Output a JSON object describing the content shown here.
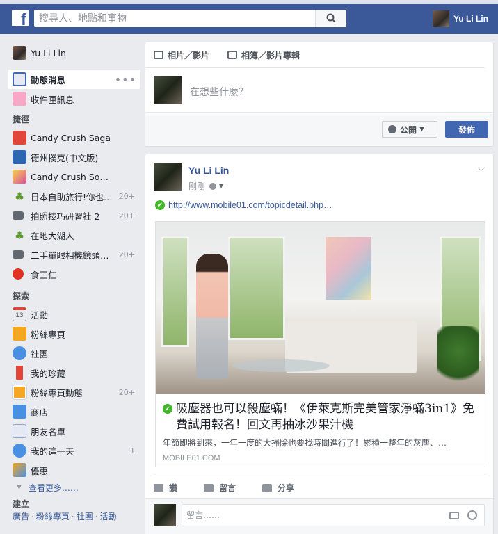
{
  "topbar": {
    "logo": "f",
    "search_placeholder": "搜尋人、地點和事物",
    "user_name": "Yu Li Lin"
  },
  "leftnav": {
    "profile_name": "Yu Li Lin",
    "main_items": [
      {
        "label": "動態消息",
        "icon": "news-feed-icon",
        "more": "•••"
      },
      {
        "label": "收件匣訊息",
        "icon": "messages-icon"
      }
    ],
    "shortcuts_header": "捷徑",
    "shortcuts": [
      {
        "label": "Candy Crush Saga",
        "icon": "candy-crush-icon",
        "count": ""
      },
      {
        "label": "德州撲克(中文版)",
        "icon": "poker-icon",
        "count": ""
      },
      {
        "label": "Candy Crush Sod…",
        "icon": "candy-crush-soda-icon",
        "count": ""
      },
      {
        "label": "日本自助旅行!你也…",
        "icon": "tree-icon",
        "count": "20+"
      },
      {
        "label": "拍照技巧研習社 2",
        "icon": "camera-icon",
        "count": "20+"
      },
      {
        "label": "在地大湖人",
        "icon": "tree-icon",
        "count": ""
      },
      {
        "label": "二手單眼相機鏡頭…",
        "icon": "camera-icon",
        "count": "20+"
      },
      {
        "label": "食三仁",
        "icon": "apple-icon",
        "count": ""
      }
    ],
    "explore_header": "探索",
    "explore": [
      {
        "label": "活動",
        "icon": "calendar-icon",
        "icon_text": "13",
        "count": ""
      },
      {
        "label": "粉絲專頁",
        "icon": "flag-icon",
        "count": ""
      },
      {
        "label": "社團",
        "icon": "groups-icon",
        "count": ""
      },
      {
        "label": "我的珍藏",
        "icon": "bookmark-icon",
        "count": ""
      },
      {
        "label": "粉絲專頁動態",
        "icon": "pages-feed-icon",
        "count": "20+"
      },
      {
        "label": "商店",
        "icon": "shop-icon",
        "count": ""
      },
      {
        "label": "朋友名單",
        "icon": "friends-list-icon",
        "count": ""
      },
      {
        "label": "我的這一天",
        "icon": "on-this-day-icon",
        "count": "1"
      },
      {
        "label": "優惠",
        "icon": "offers-icon",
        "count": ""
      }
    ],
    "see_more": "查看更多……",
    "create_header": "建立",
    "create_links": [
      "廣告",
      "粉絲專頁",
      "社團",
      "活動"
    ]
  },
  "composer": {
    "tab_photo": "相片／影片",
    "tab_album": "相簿／影片專輯",
    "placeholder": "在想些什麼？",
    "privacy": "公開",
    "post_button": "發佈"
  },
  "post": {
    "author": "Yu Li Lin",
    "time": "剛剛",
    "link_url": "http://www.mobile01.com/topicdetail.php…",
    "card_title": "吸塵器也可以殺塵蟎！《伊萊克斯完美管家淨蟎3in1》免費試用報名！回文再抽冰沙果汁機",
    "card_desc": "年節即將到來，一年一度的大掃除也要找時間進行了！累積一整年的灰塵、…",
    "card_domain": "MOBILE01.COM",
    "actions": {
      "like": "讚",
      "comment": "留言",
      "share": "分享"
    },
    "comment_placeholder": "留言……"
  },
  "colors": {
    "brand": "#3b5998",
    "link": "#365899",
    "verified": "#42b72a",
    "post_button": "#4267b2"
  }
}
